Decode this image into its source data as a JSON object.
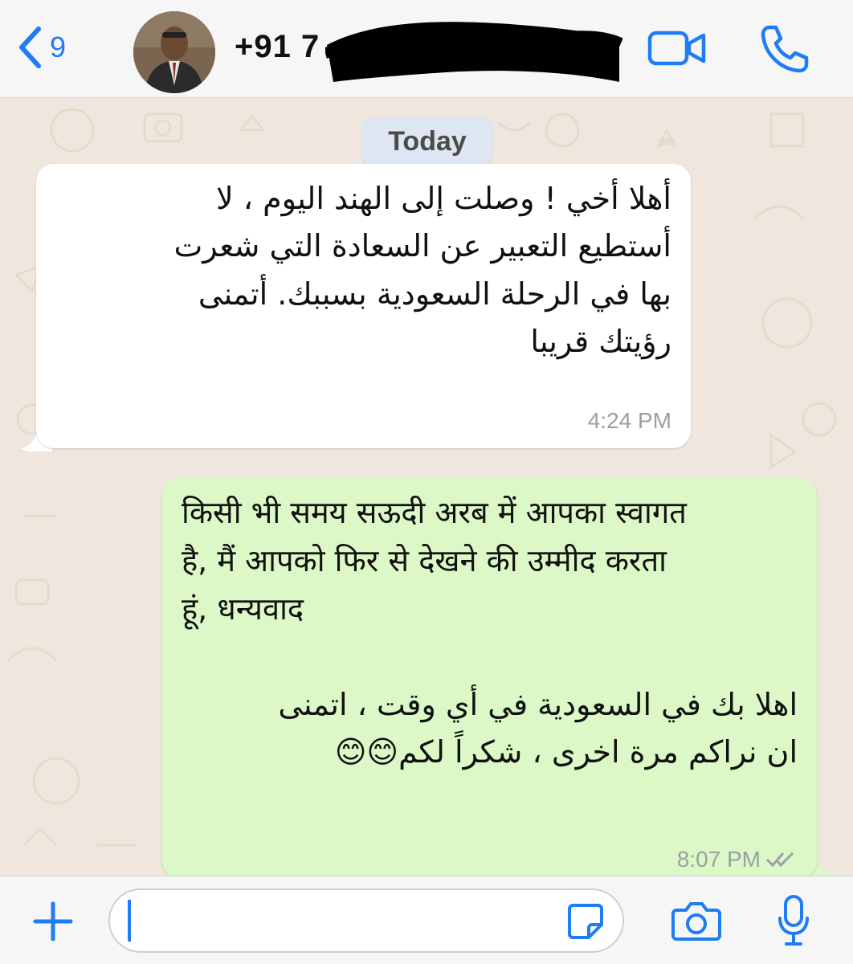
{
  "header": {
    "back_count": "9",
    "contact_name": "+91 7",
    "icons": [
      "chevron-left-icon",
      "video-camera-icon",
      "phone-icon"
    ],
    "accent_color": "#1e7cf5"
  },
  "chat": {
    "date_divider": "Today",
    "messages": [
      {
        "direction": "incoming",
        "lines": [
          "أهلا أخي !  وصلت إلى الهند اليوم ، لا",
          "أستطيع التعبير عن السعادة التي شعرت",
          "بها في الرحلة السعودية بسببك.  أتمنى",
          "رؤيتك قريبا"
        ],
        "time": "4:24 PM"
      },
      {
        "direction": "outgoing",
        "hindi_lines": [
          "किसी भी समय सऊदी अरब में आपका स्वागत",
          "है, मैं आपको फिर से देखने की उम्मीद करता",
          "हूं, धन्यवाद"
        ],
        "arabic_lines": [
          "اهلا بك في السعودية في أي وقت ، اتمنى",
          "ان نراكم مرة اخرى ، شكراً لكم😊😊"
        ],
        "time": "8:07 PM",
        "status": "double-check-icon"
      }
    ]
  },
  "input_bar": {
    "text": "",
    "icons": [
      "plus-icon",
      "sticker-icon",
      "camera-icon",
      "microphone-icon"
    ]
  }
}
